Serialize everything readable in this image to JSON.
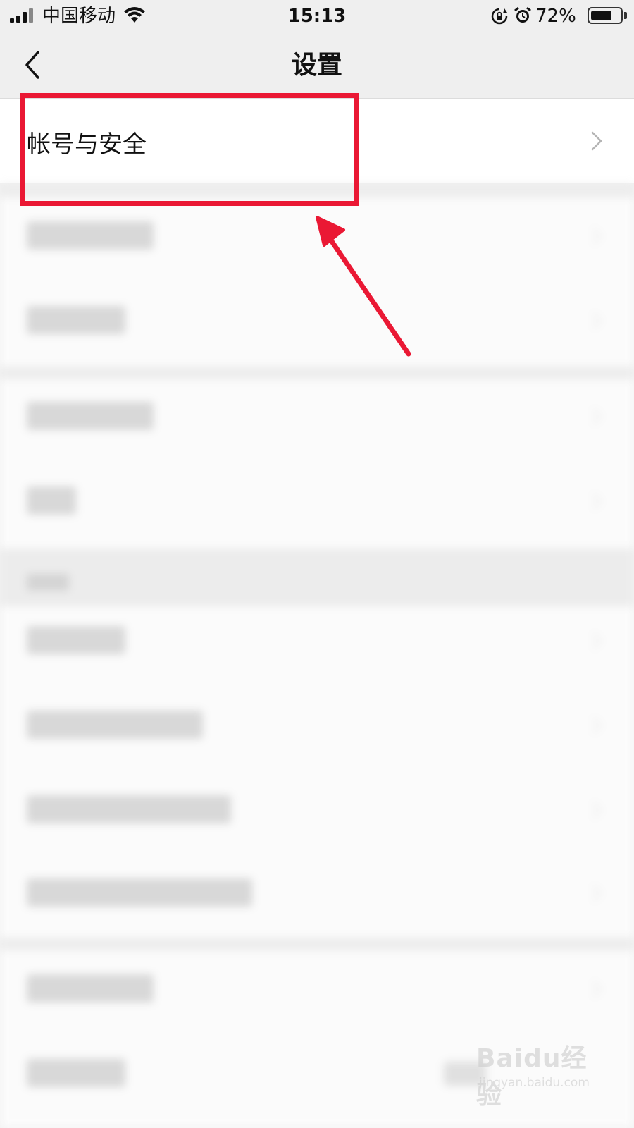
{
  "status_bar": {
    "carrier": "中国移动",
    "time": "15:13",
    "battery_percent": "72%",
    "battery_level": 0.72
  },
  "nav": {
    "title": "设置",
    "back_icon": "chevron-left-icon"
  },
  "rows": {
    "account_security": {
      "label": "帐号与安全",
      "icon": "chevron-right-icon"
    }
  },
  "blurred_rows": [
    {
      "label": "",
      "has_chevron": true
    },
    {
      "label": "",
      "has_chevron": true
    },
    {
      "label": "",
      "has_chevron": true
    },
    {
      "label": "",
      "has_chevron": true
    },
    {
      "label": "",
      "has_chevron": true
    },
    {
      "label": "",
      "has_chevron": true
    },
    {
      "label": "",
      "has_chevron": true
    },
    {
      "label": "",
      "has_chevron": true
    },
    {
      "label": "",
      "has_chevron": true
    },
    {
      "label": "",
      "has_chevron": false
    }
  ],
  "annotation": {
    "color": "#ea1834"
  },
  "watermark": {
    "logo": "Baidu经验",
    "url": "jingyan.baidu.com"
  }
}
